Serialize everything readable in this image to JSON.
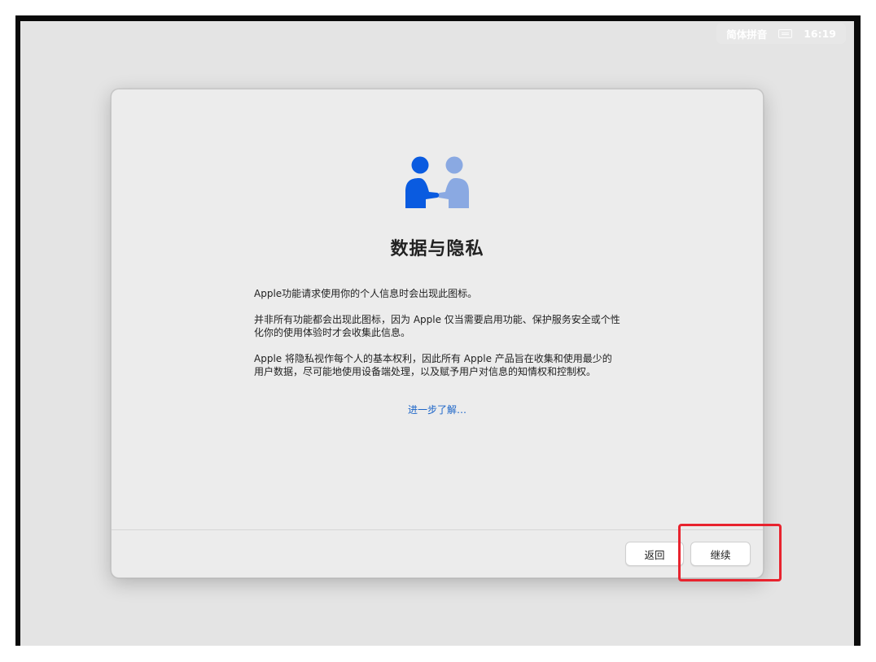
{
  "menubar": {
    "input_method": "简体拼音",
    "keyboard_icon": "keyboard-icon",
    "time": "16:19"
  },
  "dialog": {
    "icon": "handshake-people-icon",
    "title": "数据与隐私",
    "paragraphs": [
      "Apple功能请求使用你的个人信息时会出现此图标。",
      "并非所有功能都会出现此图标，因为 Apple 仅当需要启用功能、保护服务安全或个性化你的使用体验时才会收集此信息。",
      "Apple 将隐私视作每个人的基本权利，因此所有 Apple 产品旨在收集和使用最少的用户数据，尽可能地使用设备端处理，以及赋予用户对信息的知情权和控制权。"
    ],
    "learn_more": "进一步了解…",
    "buttons": {
      "back": "返回",
      "continue": "继续"
    }
  },
  "colors": {
    "icon_primary": "#0a5be0",
    "icon_secondary": "#8aa9e2",
    "link": "#1a64c8",
    "highlight": "#e8232e"
  }
}
